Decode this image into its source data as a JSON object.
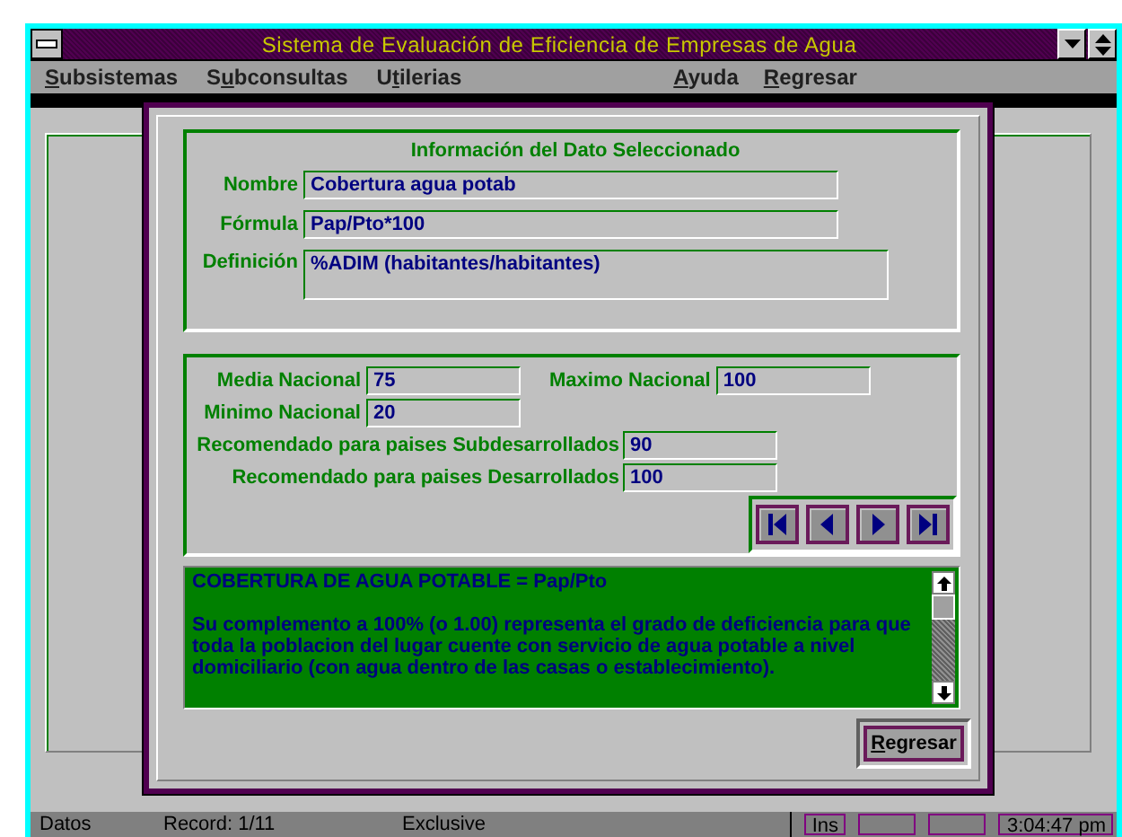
{
  "window": {
    "title": "Sistema de Evaluación de Eficiencia de Empresas de Agua"
  },
  "menu": {
    "left": [
      {
        "key": "S",
        "after": "ubsistemas"
      },
      {
        "before": "S",
        "key": "u",
        "after": "bconsultas"
      },
      {
        "before": "U",
        "key": "t",
        "after": "ilerias"
      }
    ],
    "right": [
      {
        "key": "A",
        "after": "yuda"
      },
      {
        "key": "R",
        "after": "egresar"
      }
    ]
  },
  "dialog": {
    "heading": "Información del Dato Seleccionado",
    "fields": [
      {
        "label": "Nombre",
        "value": "Cobertura agua potab",
        "kind": "line"
      },
      {
        "label": "Fórmula",
        "value": "Pap/Pto*100",
        "kind": "line"
      },
      {
        "label": "Definición",
        "value": "%ADIM (habitantes/habitantes)",
        "kind": "area"
      }
    ],
    "stats": [
      {
        "kind": "short",
        "items": [
          {
            "label": "Media Nacional",
            "value": "75"
          },
          {
            "label": "Maximo Nacional",
            "value": "100"
          }
        ]
      },
      {
        "kind": "short",
        "items": [
          {
            "label": "Minimo Nacional",
            "value": "20"
          }
        ]
      },
      {
        "kind": "long",
        "items": [
          {
            "label": "Recomendado para paises Subdesarrollados",
            "value": "90"
          }
        ]
      },
      {
        "kind": "long",
        "items": [
          {
            "label": "Recomendado para paises Desarrollados",
            "value": "100"
          }
        ]
      }
    ],
    "memo": {
      "title": "COBERTURA DE AGUA POTABLE  = Pap/Pto",
      "body": "Su complemento a 100% (o 1.00) representa el grado de deficiencia para que toda la poblacion del lugar cuente con servicio de agua potable a nivel domiciliario (con agua dentro de las casas o establecimiento)."
    },
    "button": {
      "key": "R",
      "after": "egresar"
    }
  },
  "status_bar": {
    "sections": [
      "Datos",
      "Record: 1/11",
      "Exclusive"
    ],
    "indicators": [
      "Ins"
    ],
    "clock": "3:04:47 pm"
  }
}
